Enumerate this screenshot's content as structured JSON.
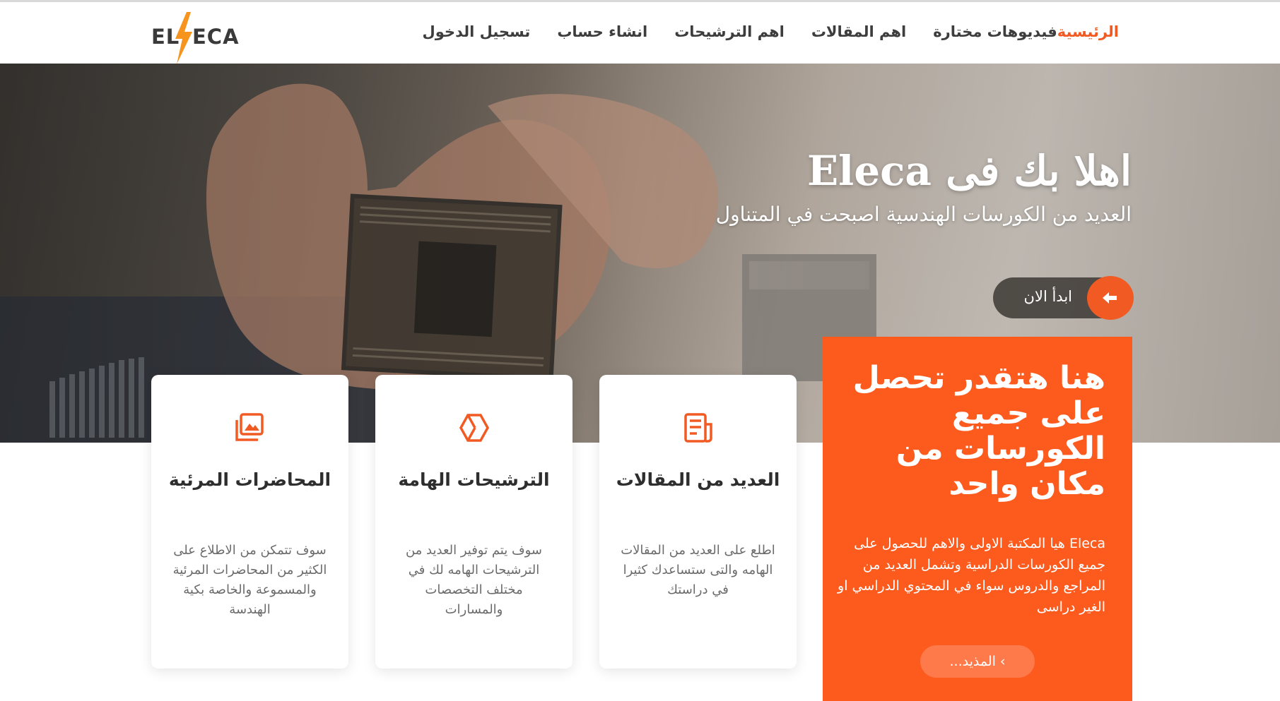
{
  "brand": {
    "logo_left": "EL",
    "logo_right": "ECA",
    "accent_color": "#f15a22",
    "panel_color": "#fd5a1e"
  },
  "nav": {
    "items": [
      {
        "label": "الرئيسية",
        "active": true
      },
      {
        "label": "فيديوهات مختارة",
        "active": false
      },
      {
        "label": "اهم المقالات",
        "active": false
      },
      {
        "label": "اهم الترشيحات",
        "active": false
      },
      {
        "label": "انشاء حساب",
        "active": false
      },
      {
        "label": "تسجيل الدخول",
        "active": false
      }
    ]
  },
  "hero": {
    "title": "اهلا بك فى Eleca",
    "subtitle": "العديد من الكورسات الهندسية اصبحت في المتناول",
    "cta_label": "ابدأ الان",
    "cta_icon": "arrow-left-icon"
  },
  "highlight": {
    "title": "هنا هتقدر تحصل على جميع الكورسات من مكان واحد",
    "description": "Eleca هيا المكتبة الاولى والاهم للحصول على جميع الكورسات الدراسية وتشمل العديد من المراجع والدروس سواء في المحتوي الدراسي او الغير دراسى",
    "more_label": "› المذيد..."
  },
  "cards": [
    {
      "icon": "images-icon",
      "title": "المحاضرات المرئية",
      "text": "سوف تتمكن من الاطلاع على الكثير من المحاضرات المرئية والمسموعة والخاصة بكية الهندسة"
    },
    {
      "icon": "hexagon-cube-icon",
      "title": "الترشيحات الهامة",
      "text": "سوف يتم توفير العديد من الترشيحات الهامه لك في مختلف التخصصات والمسارات"
    },
    {
      "icon": "newspaper-icon",
      "title": "العديد من المقالات",
      "text": "اطلع على العديد من المقالات الهامه والتى ستساعدك كثيرا في دراستك"
    }
  ]
}
